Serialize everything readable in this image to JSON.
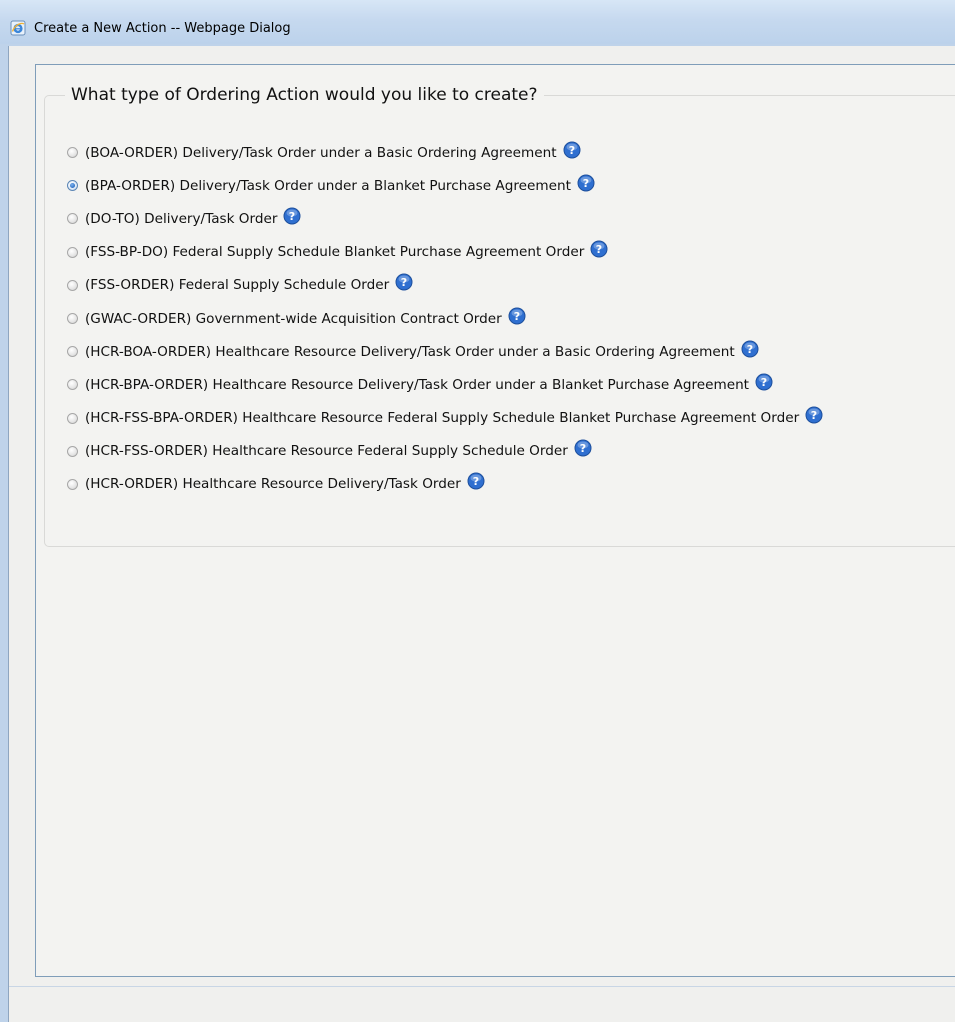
{
  "window": {
    "title": "Create a New Action -- Webpage Dialog",
    "icon": "ie-icon"
  },
  "form": {
    "legend": "What type of Ordering Action would you like to create?",
    "selected_index": 1,
    "options": [
      {
        "label": "(BOA-ORDER) Delivery/Task Order under a Basic Ordering Agreement",
        "checked": false,
        "help_icon": "help-icon"
      },
      {
        "label": "(BPA-ORDER) Delivery/Task Order under a Blanket Purchase Agreement",
        "checked": true,
        "help_icon": "help-icon"
      },
      {
        "label": "(DO-TO) Delivery/Task Order",
        "checked": false,
        "help_icon": "help-icon"
      },
      {
        "label": "(FSS-BP-DO) Federal Supply Schedule Blanket Purchase Agreement Order",
        "checked": false,
        "help_icon": "help-icon"
      },
      {
        "label": "(FSS-ORDER) Federal Supply Schedule Order",
        "checked": false,
        "help_icon": "help-icon"
      },
      {
        "label": "(GWAC-ORDER) Government-wide Acquisition Contract Order",
        "checked": false,
        "help_icon": "help-icon"
      },
      {
        "label": "(HCR-BOA-ORDER) Healthcare Resource Delivery/Task Order under a Basic Ordering Agreement",
        "checked": false,
        "help_icon": "help-icon"
      },
      {
        "label": "(HCR-BPA-ORDER) Healthcare Resource Delivery/Task Order under a Blanket Purchase Agreement",
        "checked": false,
        "help_icon": "help-icon"
      },
      {
        "label": "(HCR-FSS-BPA-ORDER) Healthcare Resource Federal Supply Schedule Blanket Purchase Agreement Order",
        "checked": false,
        "help_icon": "help-icon"
      },
      {
        "label": "(HCR-FSS-ORDER) Healthcare Resource Federal Supply Schedule Order",
        "checked": false,
        "help_icon": "help-icon"
      },
      {
        "label": "(HCR-ORDER) Healthcare Resource Delivery/Task Order",
        "checked": false,
        "help_icon": "help-icon"
      }
    ]
  },
  "colors": {
    "titlebar": "#c6d9ef",
    "dialog_background": "#f0f0ee",
    "panel_border": "#7f9db9",
    "help_icon": "#2f6fd0",
    "radio_selected": "#2e6fc4"
  }
}
